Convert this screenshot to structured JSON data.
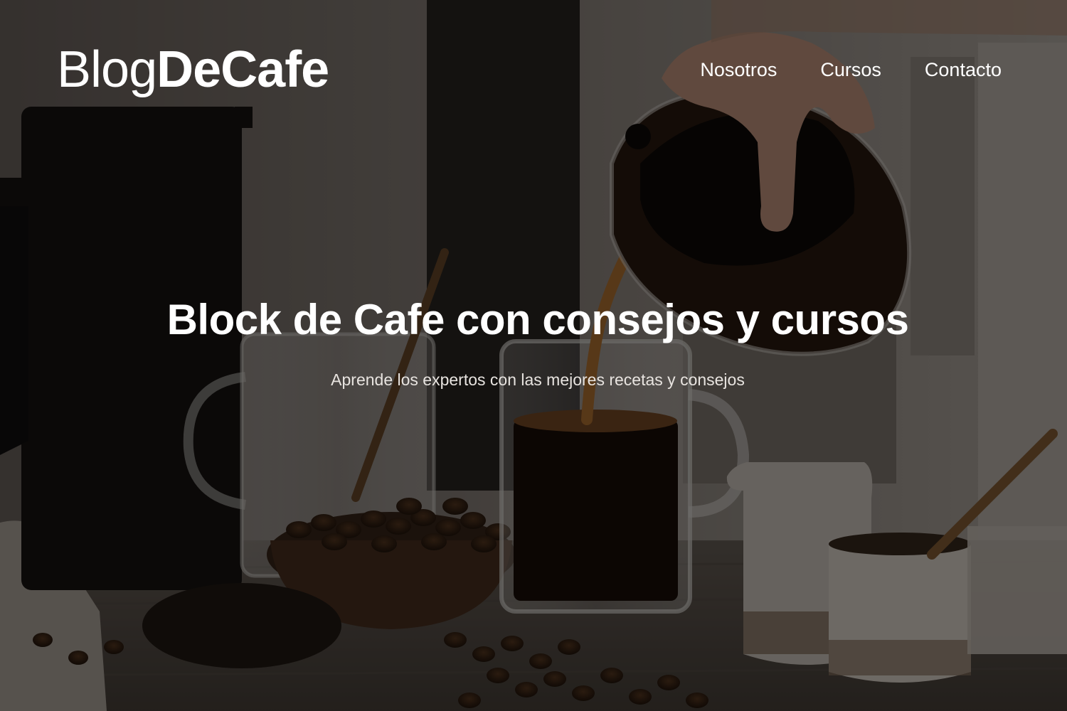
{
  "header": {
    "logo_light": "Blog",
    "logo_bold": "DeCafe",
    "nav": [
      "Nosotros",
      "Cursos",
      "Contacto"
    ]
  },
  "hero": {
    "title": "Block de Cafe con consejos y cursos",
    "subtitle": "Aprende los expertos con las mejores recetas y consejos",
    "image": "coffee-pouring-photo",
    "overlay_color": "#000000"
  }
}
